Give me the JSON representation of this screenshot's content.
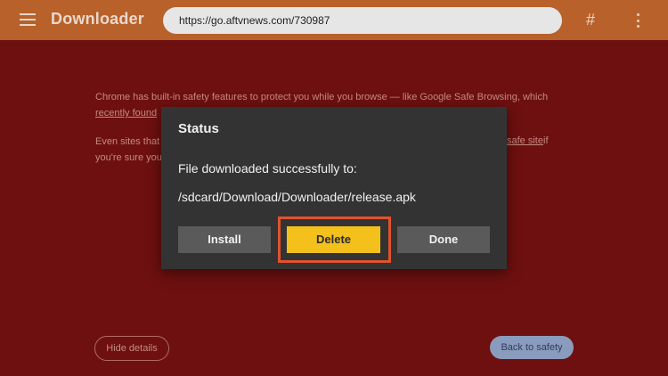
{
  "app": {
    "title": "Downloader",
    "url": "https://go.aftvnews.com/730987",
    "icons": [
      "menu-icon",
      "hash-icon",
      "more-vert-icon"
    ]
  },
  "background_page": {
    "paragraph1_text": "Chrome has built-in safety features to protect you while you browse — like Google Safe Browsing, which",
    "paragraph1_link": "recently found",
    "paragraph2_text": "Even sites that",
    "paragraph2_link": "safe site",
    "paragraph2_suffix": "if",
    "paragraph2_line2": "you're sure you",
    "hide_details_label": "Hide details",
    "back_to_safety_label": "Back to safety"
  },
  "dialog": {
    "title": "Status",
    "message": "File downloaded successfully to:",
    "path": "/sdcard/Download/Downloader/release.apk",
    "buttons": {
      "install": "Install",
      "delete": "Delete",
      "done": "Done"
    }
  },
  "colors": {
    "topbar": "#b8612a",
    "background": "#6e1010",
    "dialog": "#333333",
    "primary_button": "#f3c01c",
    "highlight": "#e2522c"
  }
}
